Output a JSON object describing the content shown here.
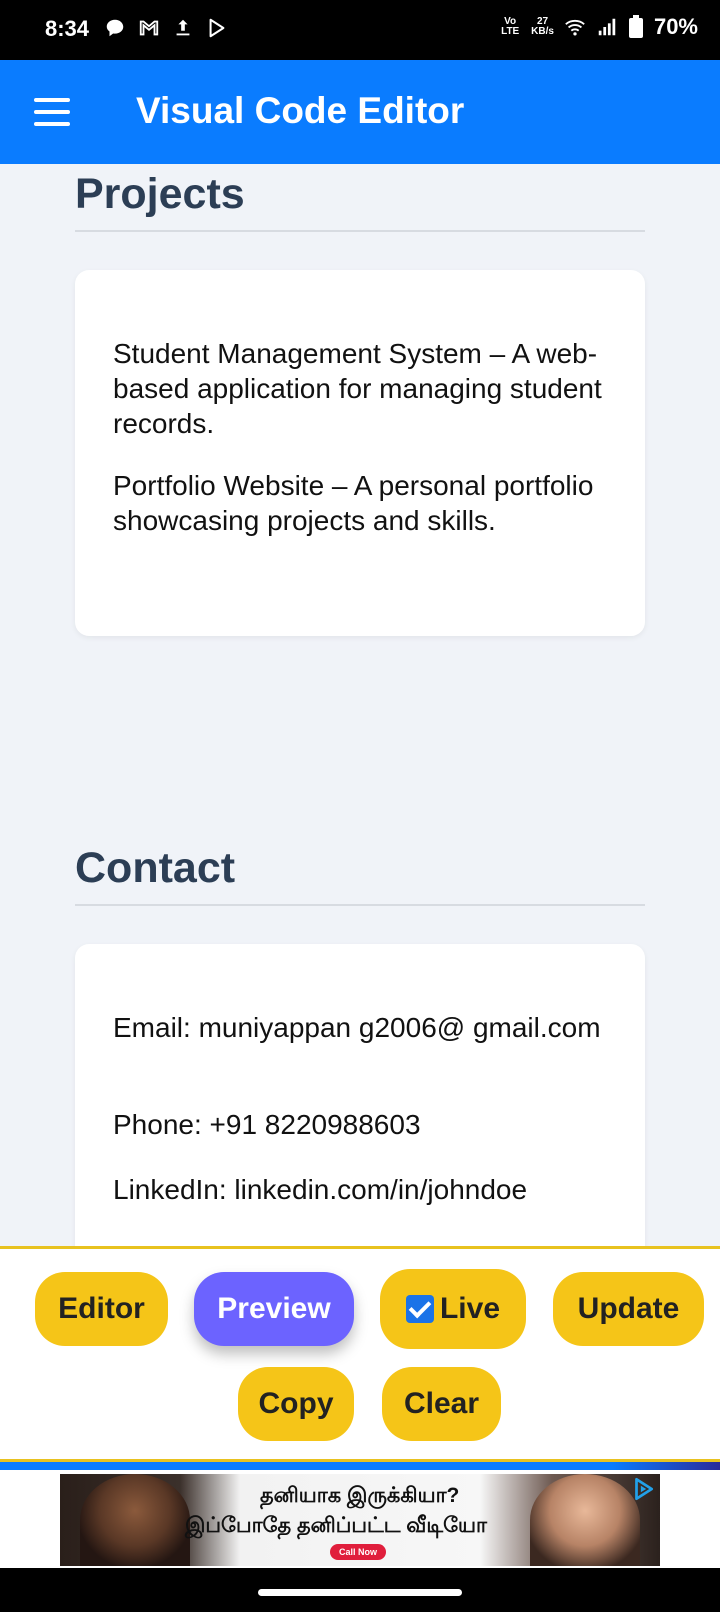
{
  "status_bar": {
    "time": "8:34",
    "volte": "Vo LTE",
    "speed_value": "27",
    "speed_unit": "KB/s",
    "battery": "70%",
    "icons": [
      "chat-bubble-icon",
      "gmail-icon",
      "upload-icon",
      "play-store-icon",
      "wifi-icon",
      "signal-icon",
      "battery-icon"
    ]
  },
  "app_bar": {
    "title": "Visual Code Editor",
    "menu_icon": "hamburger-menu-icon"
  },
  "projects": {
    "heading": "Projects",
    "items": [
      "Student Management System – A web-based application for managing student records.",
      "Portfolio Website – A personal portfolio showcasing projects and skills."
    ]
  },
  "contact": {
    "heading": "Contact",
    "email": "Email: muniyappan g2006@ gmail.com",
    "phone": "Phone: +91 8220988603",
    "linkedin": "LinkedIn: linkedin.com/in/johndoe"
  },
  "controls": {
    "editor": "Editor",
    "preview": "Preview",
    "live": "Live",
    "live_checked": true,
    "update": "Update",
    "copy": "Copy",
    "clear": "Clear",
    "active": "preview"
  },
  "ad": {
    "line1": "தனியாக இருக்கியா?",
    "line2": "இப்போதே தனிப்பட்ட வீடியோ",
    "cta": "Call Now",
    "icon": "ad-choices-icon"
  },
  "colors": {
    "app_bar": "#0a7cff",
    "button": "#f5c518",
    "button_active": "#6c63ff",
    "heading": "#2c3e55",
    "background": "#f0f3f8"
  }
}
